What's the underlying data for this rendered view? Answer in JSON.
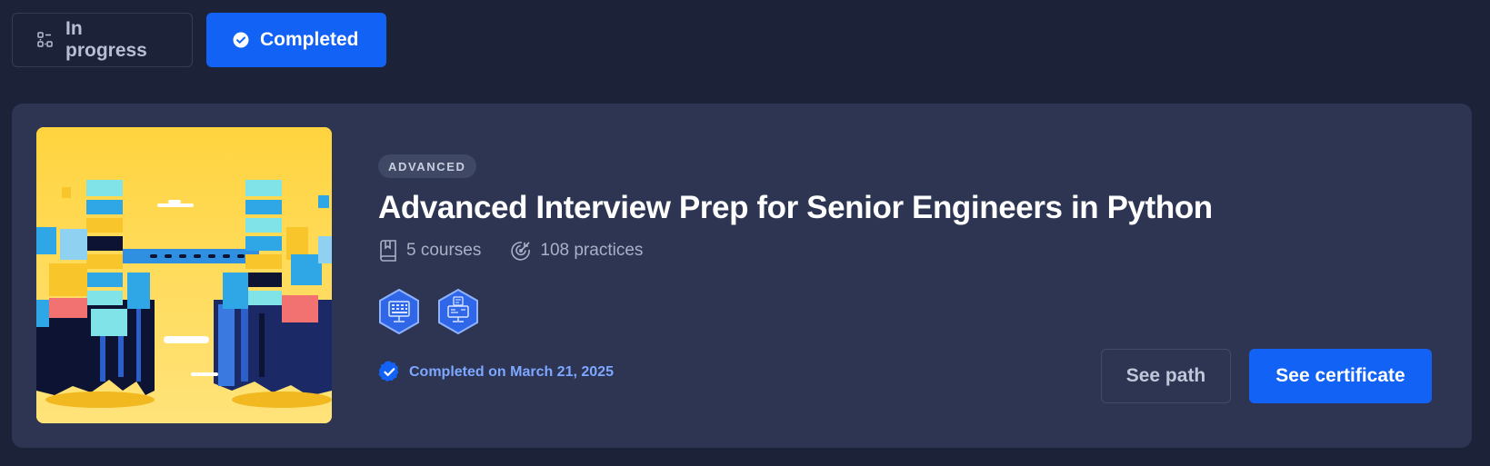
{
  "filter_tabs": [
    {
      "label": "In progress",
      "icon": "progress-icon",
      "selected": false
    },
    {
      "label": "Completed",
      "icon": "check-circle-icon",
      "selected": true
    }
  ],
  "path_card": {
    "image_icon": "isometric-city-illustration",
    "level_badge": "ADVANCED",
    "title": "Advanced Interview Prep for Senior Engineers in Python",
    "courses": {
      "icon": "book-icon",
      "text": "5 courses"
    },
    "practices": {
      "icon": "target-icon",
      "text": "108 practices"
    },
    "skill_badges": [
      "monitor-keyboard-icon",
      "monitor-document-icon"
    ],
    "completion": {
      "icon": "check-badge-icon",
      "text": "Completed on March 21, 2025"
    },
    "see_path_label": "See path",
    "see_certificate_label": "See certificate"
  },
  "colors": {
    "background": "#1c2237",
    "card": "#2d3553",
    "accent": "#1162f5",
    "completed_text": "#7ea7ff"
  }
}
